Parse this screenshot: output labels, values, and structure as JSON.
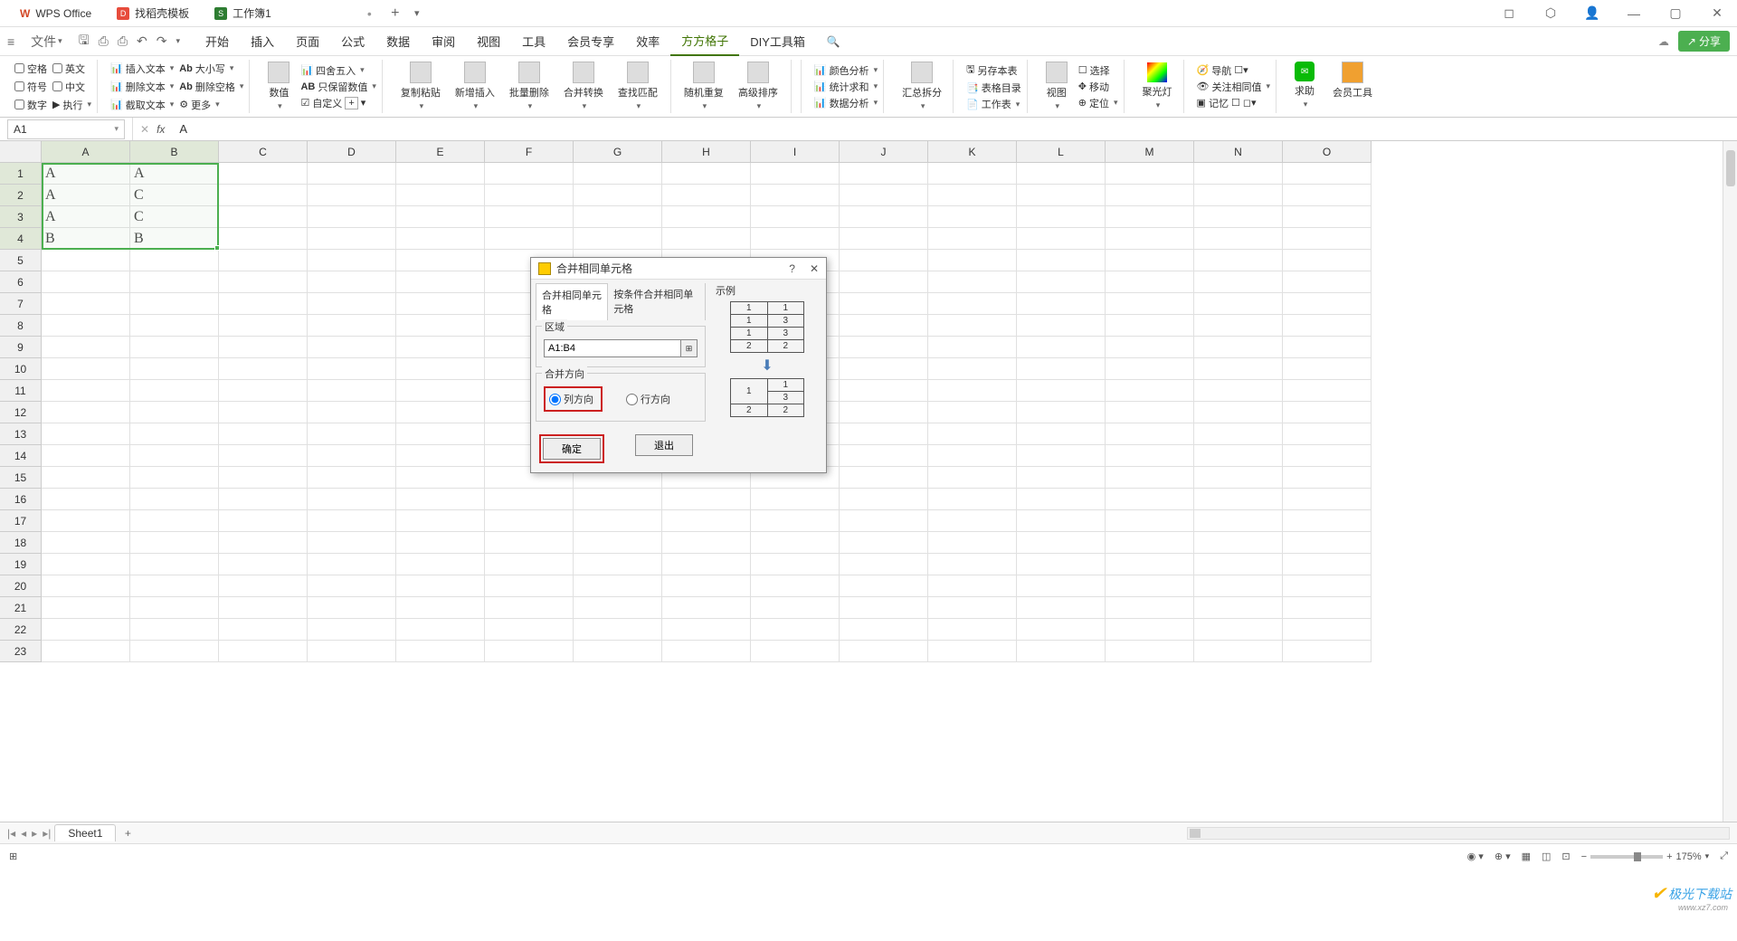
{
  "titlebar": {
    "tabs": [
      {
        "icon": "W",
        "label": "WPS Office"
      },
      {
        "icon": "D",
        "label": "找稻壳模板"
      },
      {
        "icon": "S",
        "label": "工作簿1",
        "active": true,
        "closable": true
      }
    ]
  },
  "menubar": {
    "file": "文件",
    "items": [
      "开始",
      "插入",
      "页面",
      "公式",
      "数据",
      "审阅",
      "视图",
      "工具",
      "会员专享",
      "效率",
      "方方格子",
      "DIY工具箱"
    ],
    "active": "方方格子",
    "share": "分享"
  },
  "ribbon": {
    "checks1": [
      "空格",
      "英文",
      "符号",
      "中文",
      "数字"
    ],
    "exec": "执行",
    "col2": [
      "插入文本",
      "删除文本",
      "截取文本"
    ],
    "col3": [
      "大小写",
      "删除空格",
      "更多"
    ],
    "col4_big": "数值",
    "col4_items": [
      "四舍五入",
      "只保留数值",
      "自定义"
    ],
    "bigs": [
      "复制粘贴",
      "新增插入",
      "批量删除",
      "合并转换",
      "查找匹配",
      "随机重复",
      "高级排序"
    ],
    "analysis": [
      "颜色分析",
      "统计求和",
      "数据分析"
    ],
    "hzcf": "汇总拆分",
    "save_group": [
      "另存本表",
      "表格目录",
      "工作表"
    ],
    "view": "视图",
    "view_items": [
      "选择",
      "移动",
      "定位"
    ],
    "spotlight": "聚光灯",
    "watch": [
      "导航",
      "关注相同值",
      "记忆"
    ],
    "help": "求助",
    "member": "会员工具"
  },
  "formula_bar": {
    "name_box": "A1",
    "fx": "fx",
    "value": "A"
  },
  "columns": [
    "A",
    "B",
    "C",
    "D",
    "E",
    "F",
    "G",
    "H",
    "I",
    "J",
    "K",
    "L",
    "M",
    "N",
    "O"
  ],
  "row_count": 23,
  "selected_cols": 2,
  "selected_rows": 4,
  "cells": {
    "1": [
      "A",
      "A"
    ],
    "2": [
      "A",
      "C"
    ],
    "3": [
      "A",
      "C"
    ],
    "4": [
      "B",
      "B"
    ]
  },
  "sheet": {
    "name": "Sheet1"
  },
  "status": {
    "zoom": "175%"
  },
  "dialog": {
    "title": "合并相同单元格",
    "tab1": "合并相同单元格",
    "tab2": "按条件合并相同单元格",
    "region_label": "区域",
    "range_value": "A1:B4",
    "direction_label": "合并方向",
    "radio_col": "列方向",
    "radio_row": "行方向",
    "ok": "确定",
    "exit": "退出",
    "example_label": "示例",
    "example_before": [
      [
        "1",
        "1"
      ],
      [
        "1",
        "3"
      ],
      [
        "1",
        "3"
      ],
      [
        "2",
        "2"
      ]
    ],
    "example_after": [
      [
        "1",
        "1"
      ],
      [
        "",
        "3"
      ],
      [
        "",
        "3"
      ],
      [
        "2",
        "2"
      ]
    ],
    "example_after_merge": {
      "col1_rowspan3": "1",
      "col1_row4": "2",
      "col2_row1": "1",
      "col2_rowspan2": "3",
      "col2_row4": "2"
    }
  },
  "watermark": {
    "name": "极光下载站",
    "url": "www.xz7.com"
  }
}
